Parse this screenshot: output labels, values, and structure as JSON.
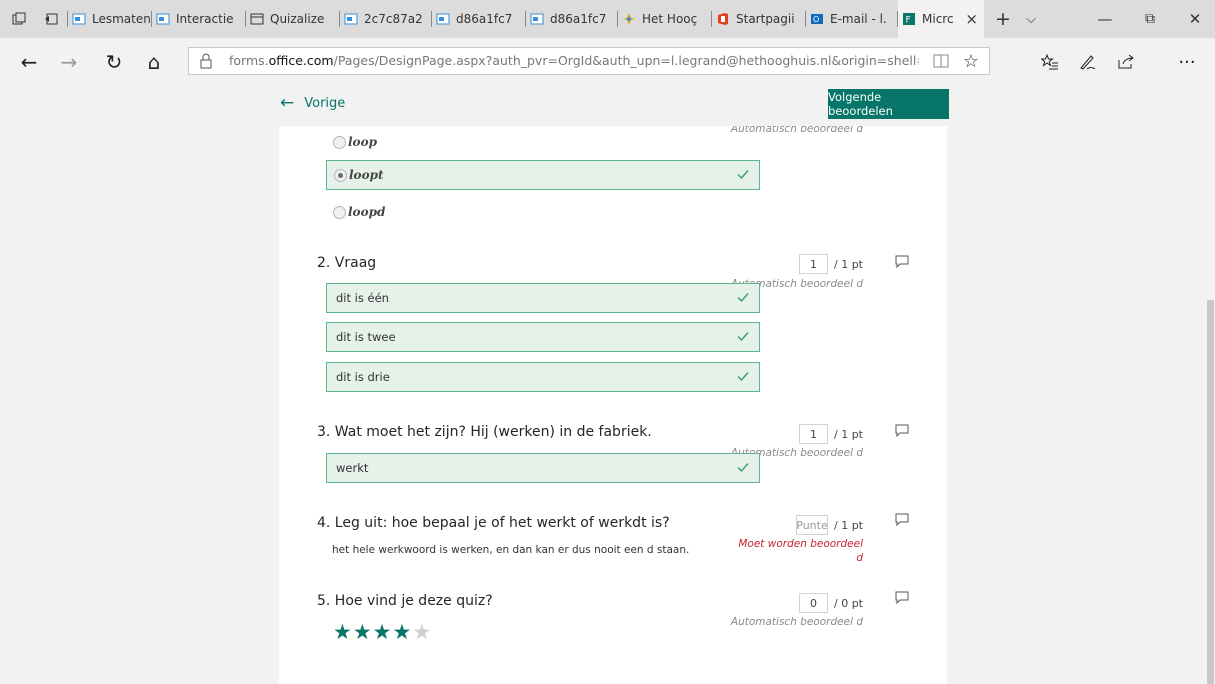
{
  "tabs": [
    {
      "label": "",
      "icon": "tab-manager-icon"
    },
    {
      "label": "",
      "icon": "tabs-aside-icon"
    },
    {
      "label": "Lesmaten",
      "icon": "lesson-icon"
    },
    {
      "label": "Interactie",
      "icon": "lesson-icon"
    },
    {
      "label": "Quizalize",
      "icon": "page-icon"
    },
    {
      "label": "2c7c87a2",
      "icon": "lesson-icon"
    },
    {
      "label": "d86a1fc7",
      "icon": "lesson-icon"
    },
    {
      "label": "d86a1fc7",
      "icon": "lesson-icon"
    },
    {
      "label": "Het Hooç",
      "icon": "school-icon"
    },
    {
      "label": "Startpagii",
      "icon": "office-icon"
    },
    {
      "label": "E-mail - l.",
      "icon": "outlook-icon"
    },
    {
      "label": "Micrc",
      "icon": "forms-icon",
      "active": true
    }
  ],
  "tab_controls": {
    "close": "×",
    "new": "+",
    "dropdown": "⌵"
  },
  "window_controls": {
    "minimize": "—",
    "restore": "⧉",
    "close": "✕"
  },
  "address": {
    "prefix": "forms.",
    "domain": "office.com",
    "path": "/Pages/DesignPage.aspx?auth_pvr=OrgId&auth_upn=l.legrand@hethooghuis.nl&origin=shell#Analysis=true&FormIc"
  },
  "nav": {
    "back": "←",
    "forward": "→",
    "refresh": "↻",
    "home": "⌂",
    "more": "···"
  },
  "form_nav": {
    "back_label": "Vorige",
    "next_label": "Volgende beoordelen"
  },
  "colors": {
    "accent": "#077568",
    "correct_border": "#5cb68e",
    "correct_bg": "#e6f1ea",
    "needs_grading": "#c4262e",
    "star_on": "#077568",
    "star_off": "#d0d0d0"
  },
  "q1": {
    "status": "Automatisch beoordeel d",
    "options": [
      {
        "label": "loop",
        "selected": false
      },
      {
        "label": "loopt",
        "selected": true
      },
      {
        "label": "loopd",
        "selected": false
      }
    ]
  },
  "q2": {
    "title": "2. Vraag",
    "points": "1",
    "max": "/ 1 pt",
    "status": "Automatisch beoordeel d",
    "options": [
      "dit is één",
      "dit is twee",
      "dit is drie"
    ]
  },
  "q3": {
    "title": "3. Wat moet het zijn? Hij (werken) in de fabriek.",
    "points": "1",
    "max": "/ 1 pt",
    "status": "Automatisch beoordeel d",
    "answer": "werkt"
  },
  "q4": {
    "title": "4. Leg uit: hoe bepaal je of het werkt of werkdt is?",
    "points_placeholder": "Punte",
    "max": "/ 1 pt",
    "status": "Moet worden beoordeel d",
    "answer": "het hele werkwoord is werken, en dan kan er dus nooit een d staan."
  },
  "q5": {
    "title": "5. Hoe vind je deze quiz?",
    "points": "0",
    "max": "/ 0 pt",
    "status": "Automatisch beoordeel d",
    "rating": 4,
    "rating_max": 5
  }
}
